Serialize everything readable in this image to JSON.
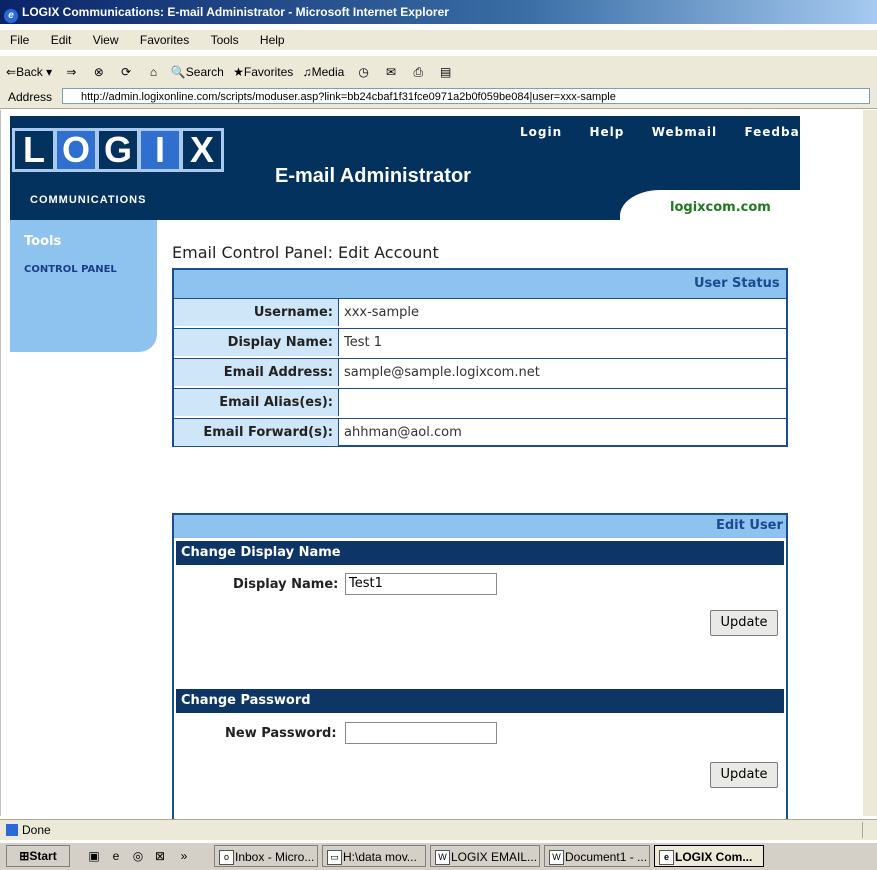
{
  "window": {
    "title": "LOGIX Communications: E-mail Administrator - Microsoft Internet Explorer"
  },
  "menu": [
    "File",
    "Edit",
    "View",
    "Favorites",
    "Tools",
    "Help"
  ],
  "toolbar": {
    "back": "Back",
    "search": "Search",
    "favorites": "Favorites",
    "media": "Media"
  },
  "address": {
    "label": "Address",
    "url": "http://admin.logixonline.com/scripts/moduser.asp?link=bb24cbaf1f31fce0971a2b0f059be084|user=xxx-sample"
  },
  "banner": {
    "logo_letters": [
      "L",
      "O",
      "G",
      "I",
      "X"
    ],
    "logo_sub": "COMMUNICATIONS",
    "app_title": "E-mail Administrator",
    "nav": [
      "Login",
      "Help",
      "Webmail",
      "Feedback"
    ],
    "domain": "logixcom.com"
  },
  "sidebar": {
    "heading": "Tools",
    "link": "CONTROL PANEL"
  },
  "page": {
    "heading": "Email Control Panel: Edit Account"
  },
  "user_status": {
    "header": "User Status",
    "rows": [
      {
        "label": "Username:",
        "value": "xxx-sample"
      },
      {
        "label": "Display Name:",
        "value": "Test 1"
      },
      {
        "label": "Email Address:",
        "value": "sample@sample.logixcom.net"
      },
      {
        "label": "Email Alias(es):",
        "value": ""
      },
      {
        "label": "Email Forward(s):",
        "value": "ahhman@aol.com"
      }
    ]
  },
  "edit_user": {
    "header": "Edit User",
    "display_section": {
      "title": "Change Display Name",
      "label": "Display Name:",
      "value": "Test1",
      "button": "Update"
    },
    "password_section": {
      "title": "Change Password",
      "label": "New Password:",
      "value": "",
      "button": "Update"
    }
  },
  "statusbar": {
    "text": "Done"
  },
  "taskbar": {
    "start": "Start",
    "tasks": [
      "Inbox - Micro...",
      "H:\\data mov...",
      "LOGIX EMAIL...",
      "Document1 - ...",
      "LOGIX Com..."
    ]
  }
}
